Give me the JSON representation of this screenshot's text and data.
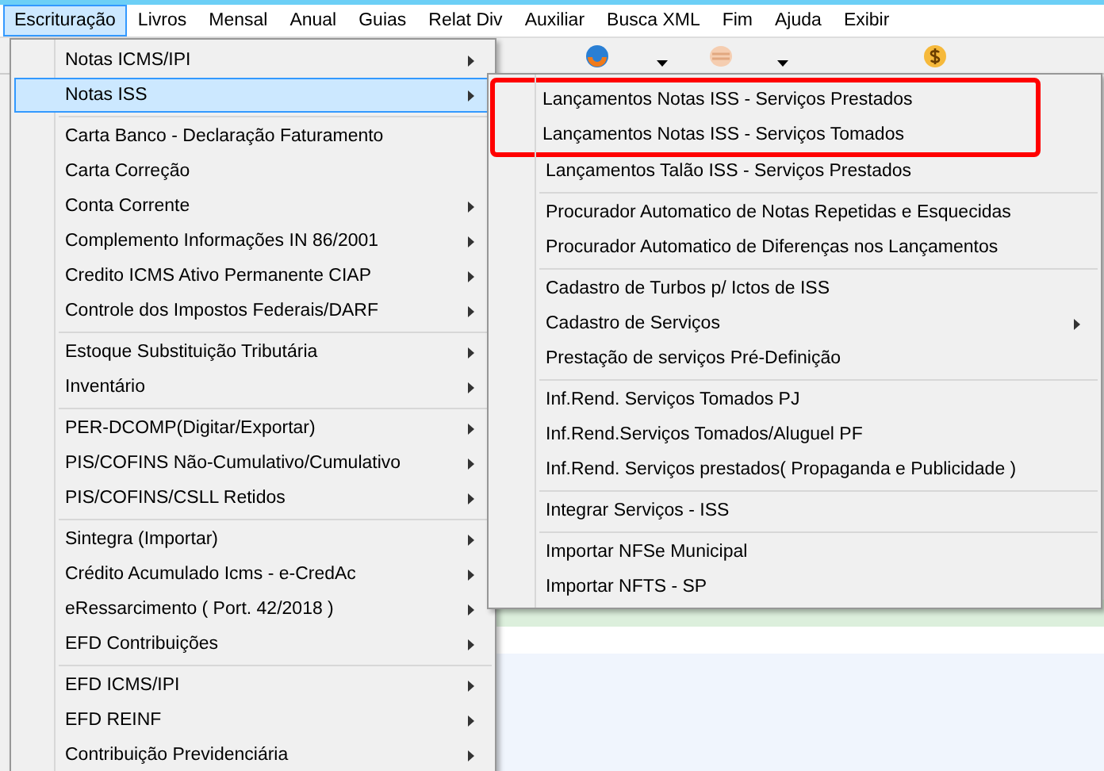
{
  "menubar": [
    {
      "label": "Escrituração",
      "selected": true
    },
    {
      "label": "Livros",
      "selected": false
    },
    {
      "label": "Mensal",
      "selected": false
    },
    {
      "label": "Anual",
      "selected": false
    },
    {
      "label": "Guias",
      "selected": false
    },
    {
      "label": "Relat Div",
      "selected": false
    },
    {
      "label": "Auxiliar",
      "selected": false
    },
    {
      "label": "Busca XML",
      "selected": false
    },
    {
      "label": "Fim",
      "selected": false
    },
    {
      "label": "Ajuda",
      "selected": false
    },
    {
      "label": "Exibir",
      "selected": false
    }
  ],
  "menu": {
    "sections": [
      {
        "items": [
          {
            "label": "Notas ICMS/IPI",
            "submenu": true,
            "selected": false
          },
          {
            "label": "Notas ISS",
            "submenu": true,
            "selected": true
          }
        ]
      },
      {
        "items": [
          {
            "label": "Carta Banco - Declaração Faturamento",
            "submenu": false,
            "selected": false
          },
          {
            "label": "Carta Correção",
            "submenu": false,
            "selected": false
          },
          {
            "label": "Conta Corrente",
            "submenu": true,
            "selected": false
          },
          {
            "label": "Complemento Informações IN 86/2001",
            "submenu": true,
            "selected": false
          },
          {
            "label": "Credito ICMS Ativo Permanente CIAP",
            "submenu": true,
            "selected": false
          },
          {
            "label": "Controle dos Impostos Federais/DARF",
            "submenu": true,
            "selected": false
          }
        ]
      },
      {
        "items": [
          {
            "label": "Estoque Substituição Tributária",
            "submenu": true,
            "selected": false
          },
          {
            "label": "Inventário",
            "submenu": true,
            "selected": false
          }
        ]
      },
      {
        "items": [
          {
            "label": "PER-DCOMP(Digitar/Exportar)",
            "submenu": true,
            "selected": false
          },
          {
            "label": "PIS/COFINS Não-Cumulativo/Cumulativo",
            "submenu": true,
            "selected": false
          },
          {
            "label": "PIS/COFINS/CSLL Retidos",
            "submenu": true,
            "selected": false
          }
        ]
      },
      {
        "items": [
          {
            "label": "Sintegra (Importar)",
            "submenu": true,
            "selected": false
          },
          {
            "label": "Crédito Acumulado Icms - e-CredAc",
            "submenu": true,
            "selected": false
          },
          {
            "label": "eRessarcimento ( Port. 42/2018 )",
            "submenu": true,
            "selected": false
          },
          {
            "label": "EFD Contribuições",
            "submenu": true,
            "selected": false
          }
        ]
      },
      {
        "items": [
          {
            "label": "EFD ICMS/IPI",
            "submenu": true,
            "selected": false
          },
          {
            "label": "EFD REINF",
            "submenu": true,
            "selected": false
          },
          {
            "label": "Contribuição Previdenciária",
            "submenu": true,
            "selected": false
          }
        ]
      }
    ]
  },
  "submenu": {
    "sections": [
      {
        "items": [
          {
            "label": "Lançamentos Notas ISS - Serviços Prestados",
            "submenu": false,
            "highlighted": true
          },
          {
            "label": "Lançamentos Notas ISS - Serviços Tomados",
            "submenu": false,
            "highlighted": true
          },
          {
            "label": "Lançamentos Talão ISS - Serviços Prestados",
            "submenu": false,
            "highlighted": false
          }
        ]
      },
      {
        "items": [
          {
            "label": "Procurador Automatico de Notas Repetidas e Esquecidas",
            "submenu": false,
            "highlighted": false
          },
          {
            "label": "Procurador Automatico de Diferenças nos Lançamentos",
            "submenu": false,
            "highlighted": false
          }
        ]
      },
      {
        "items": [
          {
            "label": "Cadastro de Turbos p/ Ictos de ISS",
            "submenu": false,
            "highlighted": false
          },
          {
            "label": "Cadastro de Serviços",
            "submenu": true,
            "highlighted": false
          },
          {
            "label": "Prestação de serviços Pré-Definição",
            "submenu": false,
            "highlighted": false
          }
        ]
      },
      {
        "items": [
          {
            "label": "Inf.Rend. Serviços Tomados PJ",
            "submenu": false,
            "highlighted": false
          },
          {
            "label": "Inf.Rend.Serviços Tomados/Aluguel PF",
            "submenu": false,
            "highlighted": false
          },
          {
            "label": "Inf.Rend. Serviços prestados( Propaganda e Publicidade )",
            "submenu": false,
            "highlighted": false
          }
        ]
      },
      {
        "items": [
          {
            "label": "Integrar Serviços - ISS",
            "submenu": false,
            "highlighted": false
          }
        ]
      },
      {
        "items": [
          {
            "label": "Importar NFSe Municipal",
            "submenu": false,
            "highlighted": false
          },
          {
            "label": "Importar NFTS - SP",
            "submenu": false,
            "highlighted": false
          }
        ]
      }
    ]
  }
}
